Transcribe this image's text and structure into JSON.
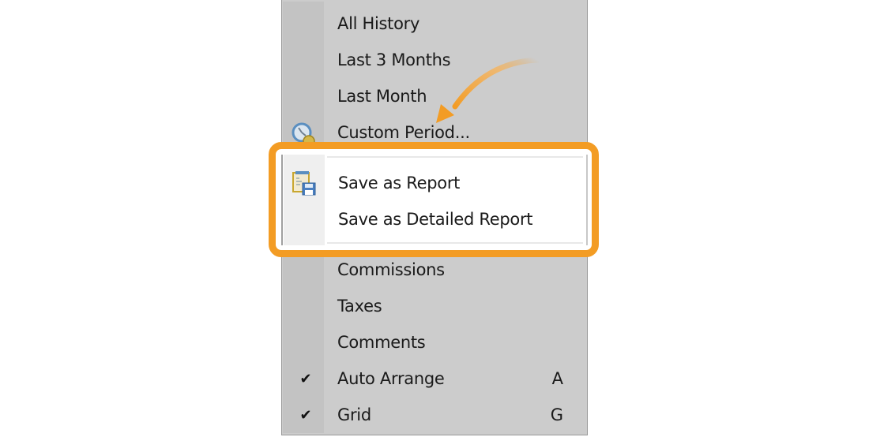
{
  "menu": {
    "items_top": [
      {
        "label": "All History",
        "icon": null
      },
      {
        "label": "Last 3 Months",
        "icon": null
      },
      {
        "label": "Last Month",
        "icon": null
      },
      {
        "label": "Custom Period...",
        "icon": "clock-icon"
      }
    ],
    "items_highlighted": [
      {
        "label": "Save as Report",
        "icon": "save-report-icon"
      },
      {
        "label": "Save as Detailed Report",
        "icon": null
      }
    ],
    "items_bottom": [
      {
        "label": "Commissions",
        "checked": false,
        "shortcut": ""
      },
      {
        "label": "Taxes",
        "checked": false,
        "shortcut": ""
      },
      {
        "label": "Comments",
        "checked": false,
        "shortcut": ""
      },
      {
        "label": "Auto Arrange",
        "checked": true,
        "shortcut": "A"
      },
      {
        "label": "Grid",
        "checked": true,
        "shortcut": "G"
      }
    ]
  },
  "annotation": {
    "highlight_color": "#f39c24",
    "arrow_color": "#f39c24"
  },
  "icons": {
    "check": "✔"
  }
}
